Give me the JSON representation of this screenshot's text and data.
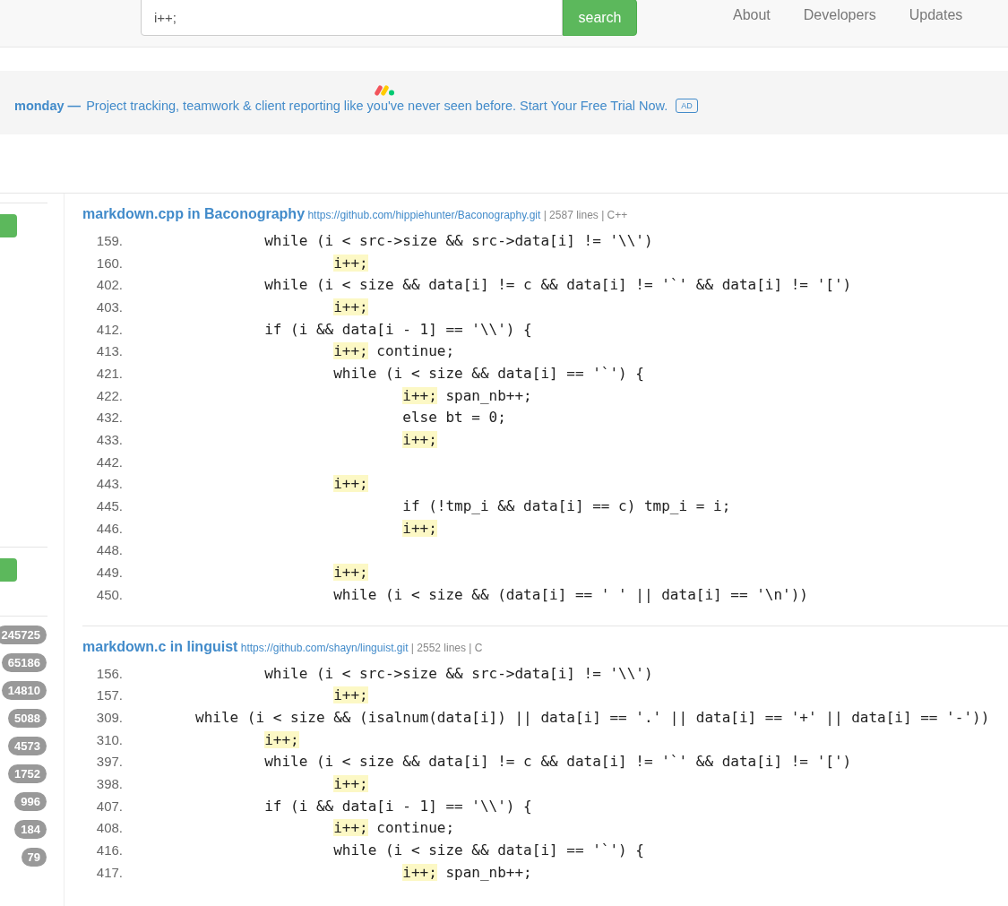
{
  "search": {
    "value": "i++;",
    "button": "search"
  },
  "nav": [
    "About",
    "Developers",
    "Updates"
  ],
  "ad": {
    "brand": "monday —",
    "text": "Project tracking, teamwork & client reporting like you've never seen before. Start Your Free Trial Now.",
    "badge": "AD"
  },
  "sidebar": {
    "counts": [
      "245725",
      "65186",
      "14810",
      "5088",
      "4573",
      "1752",
      "996",
      "184",
      "79"
    ]
  },
  "results": [
    {
      "title": "markdown.cpp in Baconography",
      "url": "https://github.com/hippiehunter/Baconography.git",
      "meta": "| 2587 lines | C++",
      "lines": [
        {
          "number": "159.",
          "parts": [
            {
              "text": "\t\twhile (i < src->size && src->data[i] != '\\\\')",
              "highlight": false
            }
          ]
        },
        {
          "number": "160.",
          "parts": [
            {
              "text": "\t\t\ti++;",
              "highlight": true
            }
          ]
        },
        {
          "number": "402.",
          "parts": [
            {
              "text": "\t\twhile (i < size && data[i] != c && data[i] != '`' && data[i] != '[')",
              "highlight": false
            }
          ]
        },
        {
          "number": "403.",
          "parts": [
            {
              "text": "\t\t\ti++;",
              "highlight": true
            }
          ]
        },
        {
          "number": "412.",
          "parts": [
            {
              "text": "\t\tif (i && data[i - 1] == '\\\\') {",
              "highlight": false
            }
          ]
        },
        {
          "number": "413.",
          "parts": [
            {
              "text": "\t\t\ti++;",
              "highlight": true
            },
            {
              "text": " continue;",
              "highlight": false
            }
          ]
        },
        {
          "number": "421.",
          "parts": [
            {
              "text": "\t\t\twhile (i < size && data[i] == '`') {",
              "highlight": false
            }
          ]
        },
        {
          "number": "422.",
          "parts": [
            {
              "text": "\t\t\t\ti++;",
              "highlight": true
            },
            {
              "text": " span_nb++;",
              "highlight": false
            }
          ]
        },
        {
          "number": "432.",
          "parts": [
            {
              "text": "\t\t\t\telse bt = 0;",
              "highlight": false
            }
          ]
        },
        {
          "number": "433.",
          "parts": [
            {
              "text": "\t\t\t\ti++;",
              "highlight": true
            }
          ]
        },
        {
          "number": "442."
        },
        {
          "number": "443.",
          "parts": [
            {
              "text": "\t\t\ti++;",
              "highlight": true
            }
          ]
        },
        {
          "number": "445.",
          "parts": [
            {
              "text": "\t\t\t\tif (!tmp_i && data[i] == c) tmp_i = i;",
              "highlight": false
            }
          ]
        },
        {
          "number": "446.",
          "parts": [
            {
              "text": "\t\t\t\ti++;",
              "highlight": true
            }
          ]
        },
        {
          "number": "448."
        },
        {
          "number": "449.",
          "parts": [
            {
              "text": "\t\t\ti++;",
              "highlight": true
            }
          ]
        },
        {
          "number": "450.",
          "parts": [
            {
              "text": "\t\t\twhile (i < size && (data[i] == ' ' || data[i] == '\\n'))",
              "highlight": false
            }
          ]
        }
      ]
    },
    {
      "title": "markdown.c in linguist",
      "url": "https://github.com/shayn/linguist.git",
      "meta": "| 2552 lines | C",
      "lines": [
        {
          "number": "156.",
          "parts": [
            {
              "text": "\t\twhile (i < src->size && src->data[i] != '\\\\')",
              "highlight": false
            }
          ]
        },
        {
          "number": "157.",
          "parts": [
            {
              "text": "\t\t\ti++;",
              "highlight": true
            }
          ]
        },
        {
          "number": "309.",
          "parts": [
            {
              "text": "\twhile (i < size && (isalnum(data[i]) || data[i] == '.' || data[i] == '+' || data[i] == '-'))",
              "highlight": false
            }
          ]
        },
        {
          "number": "310.",
          "parts": [
            {
              "text": "\t\ti++;",
              "highlight": true
            }
          ]
        },
        {
          "number": "397.",
          "parts": [
            {
              "text": "\t\twhile (i < size && data[i] != c && data[i] != '`' && data[i] != '[')",
              "highlight": false
            }
          ]
        },
        {
          "number": "398.",
          "parts": [
            {
              "text": "\t\t\ti++;",
              "highlight": true
            }
          ]
        },
        {
          "number": "407.",
          "parts": [
            {
              "text": "\t\tif (i && data[i - 1] == '\\\\') {",
              "highlight": false
            }
          ]
        },
        {
          "number": "408.",
          "parts": [
            {
              "text": "\t\t\ti++;",
              "highlight": true
            },
            {
              "text": " continue;",
              "highlight": false
            }
          ]
        },
        {
          "number": "416.",
          "parts": [
            {
              "text": "\t\t\twhile (i < size && data[i] == '`') {",
              "highlight": false
            }
          ]
        },
        {
          "number": "417.",
          "parts": [
            {
              "text": "\t\t\t\ti++;",
              "highlight": true
            },
            {
              "text": " span_nb++;",
              "highlight": false
            }
          ]
        }
      ]
    }
  ]
}
